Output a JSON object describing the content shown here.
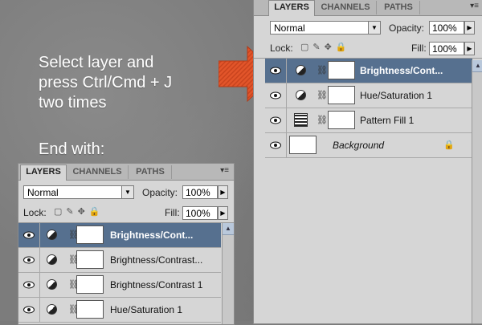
{
  "instructions": {
    "line1": "Select layer and",
    "line2": "press Ctrl/Cmd + J",
    "line3": "two times",
    "line4": "End with:"
  },
  "colors": {
    "arrow": "#e2552a",
    "selected_row": "#56708f"
  },
  "panel_main": {
    "tabs": [
      "LAYERS",
      "CHANNELS",
      "PATHS"
    ],
    "menu_icon": "panel-menu-icon",
    "blend_mode": "Normal",
    "opacity_label": "Opacity:",
    "opacity_value": "100%",
    "lock_label": "Lock:",
    "fill_label": "Fill:",
    "fill_value": "100%",
    "layers": [
      {
        "name": "Brightness/Cont...",
        "type": "adjustment",
        "selected": true
      },
      {
        "name": "Hue/Saturation 1",
        "type": "adjustment",
        "selected": false
      },
      {
        "name": "Pattern Fill 1",
        "type": "pattern",
        "selected": false
      },
      {
        "name": "Background",
        "type": "background",
        "selected": false
      }
    ]
  },
  "panel_result": {
    "tabs": [
      "LAYERS",
      "CHANNELS",
      "PATHS"
    ],
    "blend_mode": "Normal",
    "opacity_label": "Opacity:",
    "opacity_value": "100%",
    "lock_label": "Lock:",
    "fill_label": "Fill:",
    "fill_value": "100%",
    "layers": [
      {
        "name": "Brightness/Cont...",
        "selected": true
      },
      {
        "name": "Brightness/Contrast...",
        "selected": false
      },
      {
        "name": "Brightness/Contrast 1",
        "selected": false
      },
      {
        "name": "Hue/Saturation 1",
        "selected": false
      }
    ]
  }
}
